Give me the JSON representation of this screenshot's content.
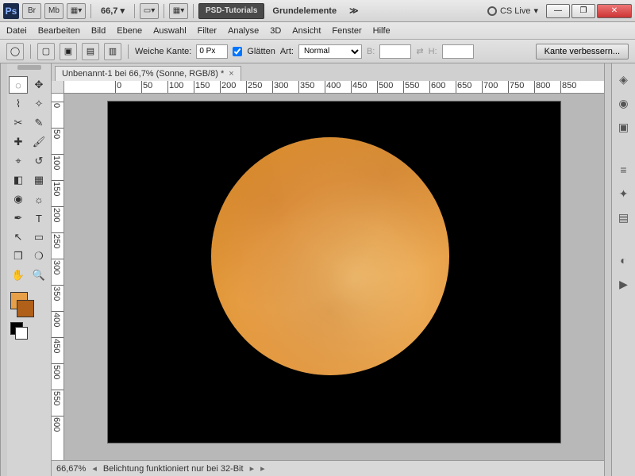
{
  "title": {
    "zoom_label": "66,7",
    "btn1": "Br",
    "btn2": "Mb",
    "darktab": "PSD-Tutorials",
    "tab2": "Grundelemente",
    "cslive": "CS Live"
  },
  "menu": {
    "items": [
      "Datei",
      "Bearbeiten",
      "Bild",
      "Ebene",
      "Auswahl",
      "Filter",
      "Analyse",
      "3D",
      "Ansicht",
      "Fenster",
      "Hilfe"
    ]
  },
  "options": {
    "feather_label": "Weiche Kante:",
    "feather_value": "0 Px",
    "antialias_label": "Glätten",
    "style_label": "Art:",
    "style_value": "Normal",
    "width_label": "B:",
    "height_label": "H:",
    "refine_btn": "Kante verbessern..."
  },
  "doc": {
    "tab": "Unbenannt-1 bei 66,7% (Sonne, RGB/8) *"
  },
  "ruler": {
    "h": [
      "0",
      "50",
      "100",
      "150",
      "200",
      "250",
      "300",
      "350",
      "400",
      "450",
      "500",
      "550",
      "600",
      "650",
      "700",
      "750",
      "800",
      "850"
    ],
    "v": [
      "0",
      "50",
      "100",
      "150",
      "200",
      "250",
      "300",
      "350",
      "400",
      "450",
      "500",
      "550",
      "600"
    ]
  },
  "status": {
    "zoom": "66,67%",
    "msg": "Belichtung funktioniert nur bei 32-Bit"
  },
  "colors": {
    "fg": "#e8a048",
    "bg": "#b06018"
  }
}
